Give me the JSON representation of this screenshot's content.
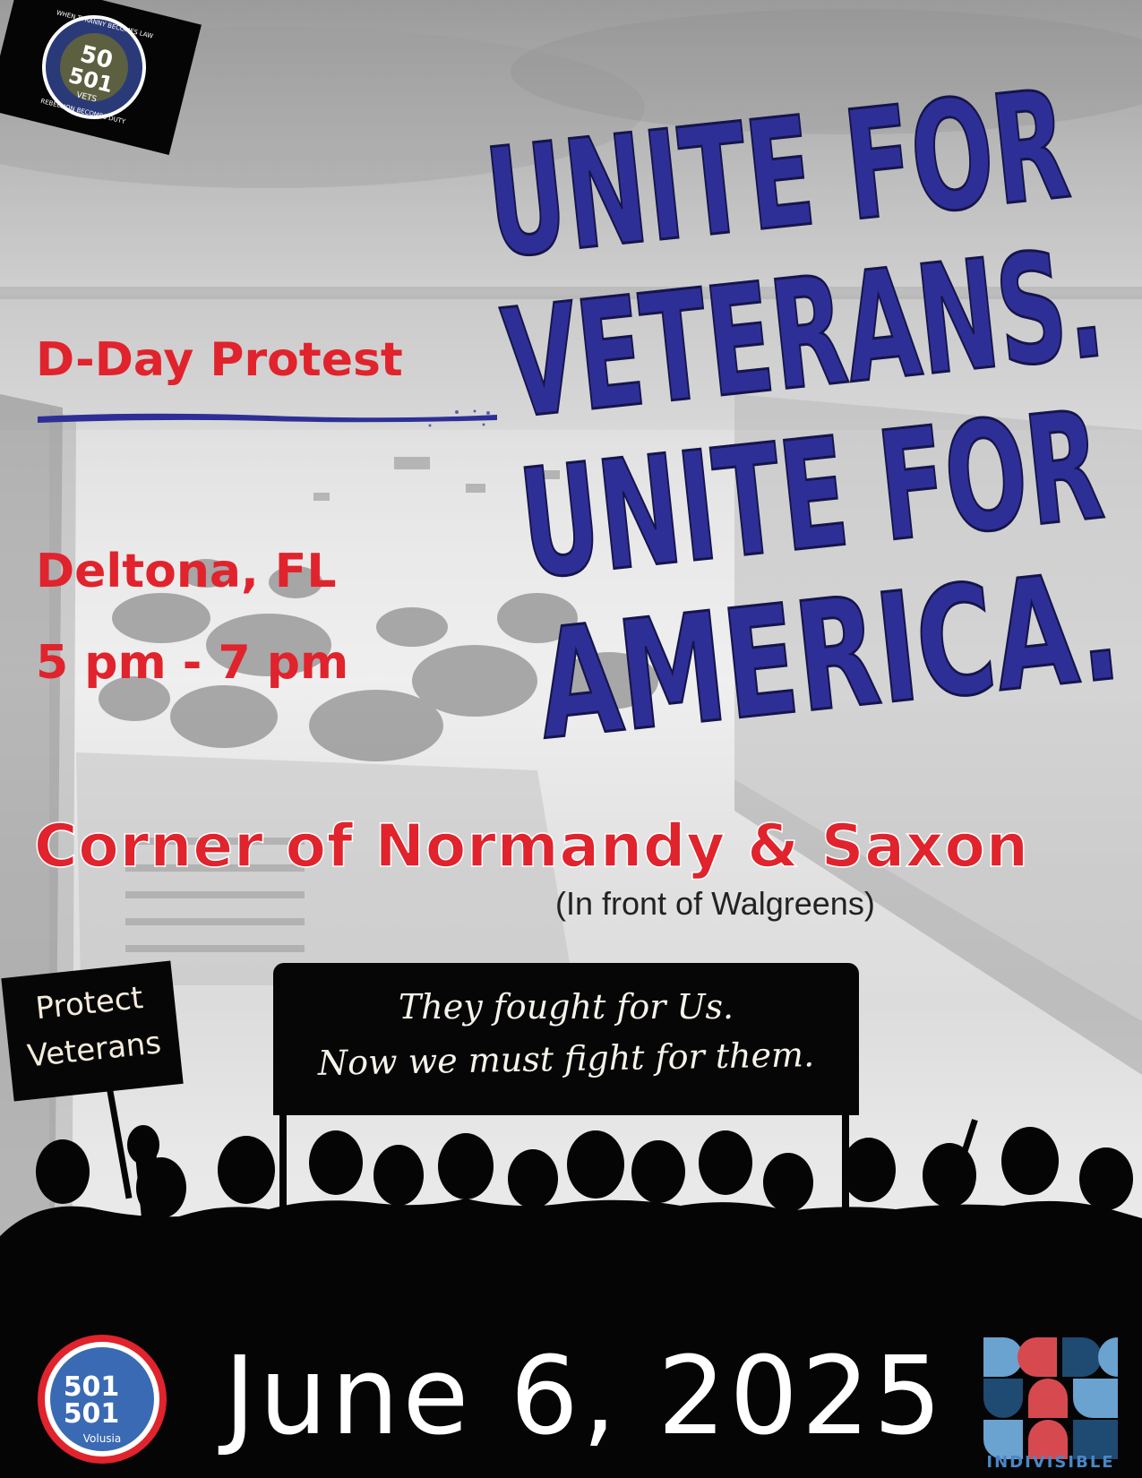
{
  "headline": {
    "line1": "UNITE FOR",
    "line2": "VETERANS.",
    "line3": "UNITE FOR",
    "line4": "AMERICA."
  },
  "event": {
    "name": "D-Day Protest",
    "city": "Deltona, FL",
    "time": "5 pm - 7 pm",
    "location": "Corner of Normandy & Saxon",
    "location_note": "(In front of Walgreens)",
    "date": "June 6, 2025"
  },
  "signs": {
    "left": {
      "line1": "Protect",
      "line2": "Veterans"
    },
    "banner": {
      "line1": "They fought for Us.",
      "line2": "Now we must fight for them."
    },
    "right_logo": {
      "top_arc": "WHEN TYRANNY BECOMES LAW",
      "bottom_arc": "REBELLION BECOMES DUTY",
      "num1": "50",
      "num2": "501",
      "label": "VETS"
    }
  },
  "logos": {
    "left": {
      "num1": "501",
      "num2": "501",
      "label": "Volusia"
    },
    "right": {
      "label": "INDIVISIBLE"
    }
  },
  "colors": {
    "headline_blue": "#2e2f96",
    "accent_red": "#e0232c",
    "footer_black": "#050505",
    "indivisible_red": "#d64a4f",
    "indivisible_blue": "#6aa2d0",
    "indivisible_navy": "#1f4a72"
  }
}
